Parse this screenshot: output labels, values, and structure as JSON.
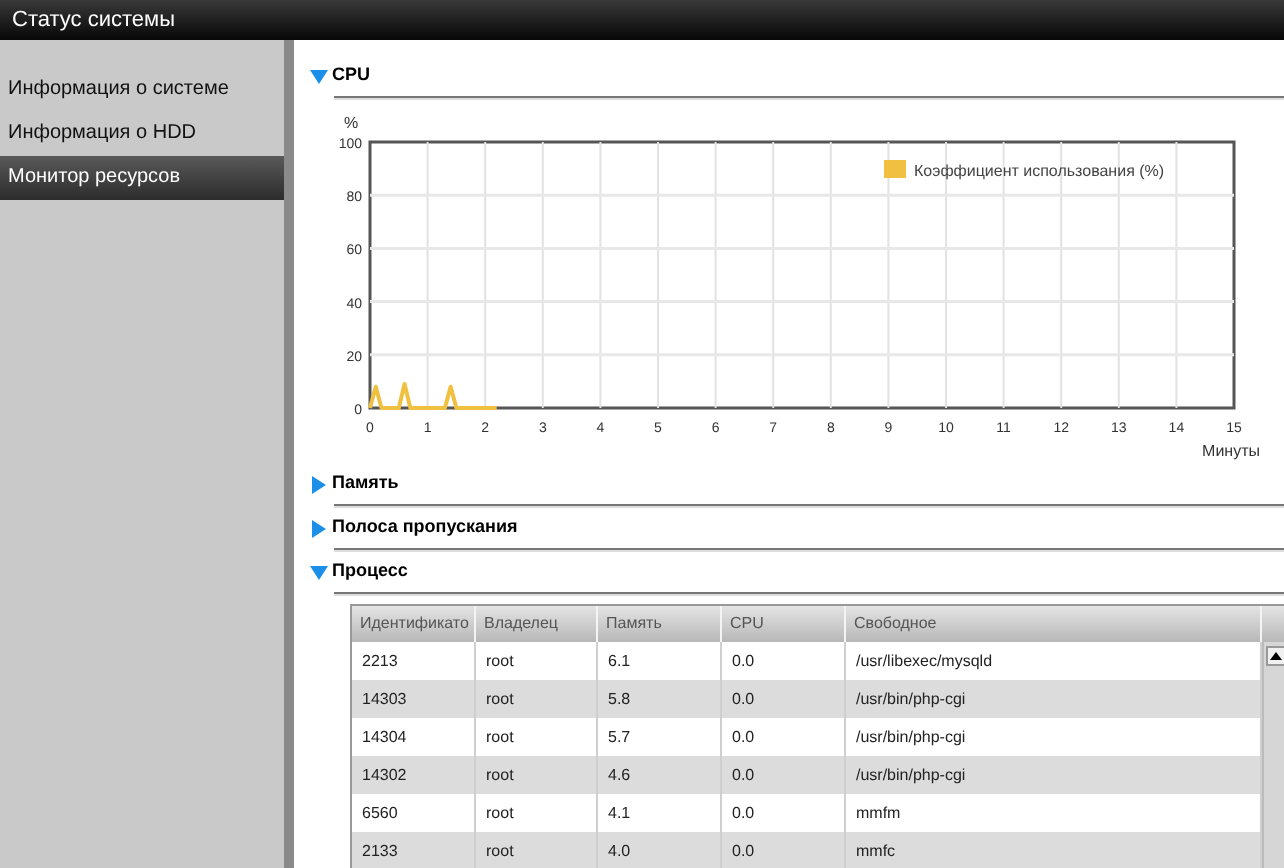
{
  "window": {
    "title": "Статус системы"
  },
  "sidebar": {
    "items": [
      {
        "label": "Информация о системе",
        "selected": false
      },
      {
        "label": "Информация о HDD",
        "selected": false
      },
      {
        "label": "Монитор ресурсов",
        "selected": true
      }
    ]
  },
  "sections": [
    {
      "title": "CPU",
      "expanded": true,
      "kind": "chart",
      "chart_data": {
        "type": "line",
        "ylabel": "%",
        "xlabel": "Минуты",
        "x": [
          0,
          0.1,
          0.2,
          0.5,
          0.6,
          0.7,
          1.3,
          1.4,
          1.5,
          2.2
        ],
        "series": [
          {
            "name": "Коэффициент использования (%)",
            "color": "#f0c040",
            "values": [
              0,
              8,
              0,
              0,
              9,
              0,
              0,
              8,
              0,
              0
            ]
          }
        ],
        "xlim": [
          0,
          15
        ],
        "ylim": [
          0,
          100
        ],
        "xticks": [
          0,
          1,
          2,
          3,
          4,
          5,
          6,
          7,
          8,
          9,
          10,
          11,
          12,
          13,
          14,
          15
        ],
        "yticks": [
          0,
          20,
          40,
          60,
          80,
          100
        ],
        "grid": true
      }
    },
    {
      "title": "Память",
      "expanded": false,
      "kind": "collapsed"
    },
    {
      "title": "Полоса пропускания",
      "expanded": false,
      "kind": "collapsed"
    },
    {
      "title": "Процесс",
      "expanded": true,
      "kind": "table",
      "table": {
        "columns": [
          "Идентификато",
          "Владелец",
          "Память",
          "CPU",
          "Свободное"
        ],
        "rows": [
          [
            "2213",
            "root",
            "6.1",
            "0.0",
            "/usr/libexec/mysqld"
          ],
          [
            "14303",
            "root",
            "5.8",
            "0.0",
            "/usr/bin/php-cgi"
          ],
          [
            "14304",
            "root",
            "5.7",
            "0.0",
            "/usr/bin/php-cgi"
          ],
          [
            "14302",
            "root",
            "4.6",
            "0.0",
            "/usr/bin/php-cgi"
          ],
          [
            "6560",
            "root",
            "4.1",
            "0.0",
            "mmfm"
          ],
          [
            "2133",
            "root",
            "4.0",
            "0.0",
            "mmfc"
          ]
        ]
      }
    }
  ]
}
